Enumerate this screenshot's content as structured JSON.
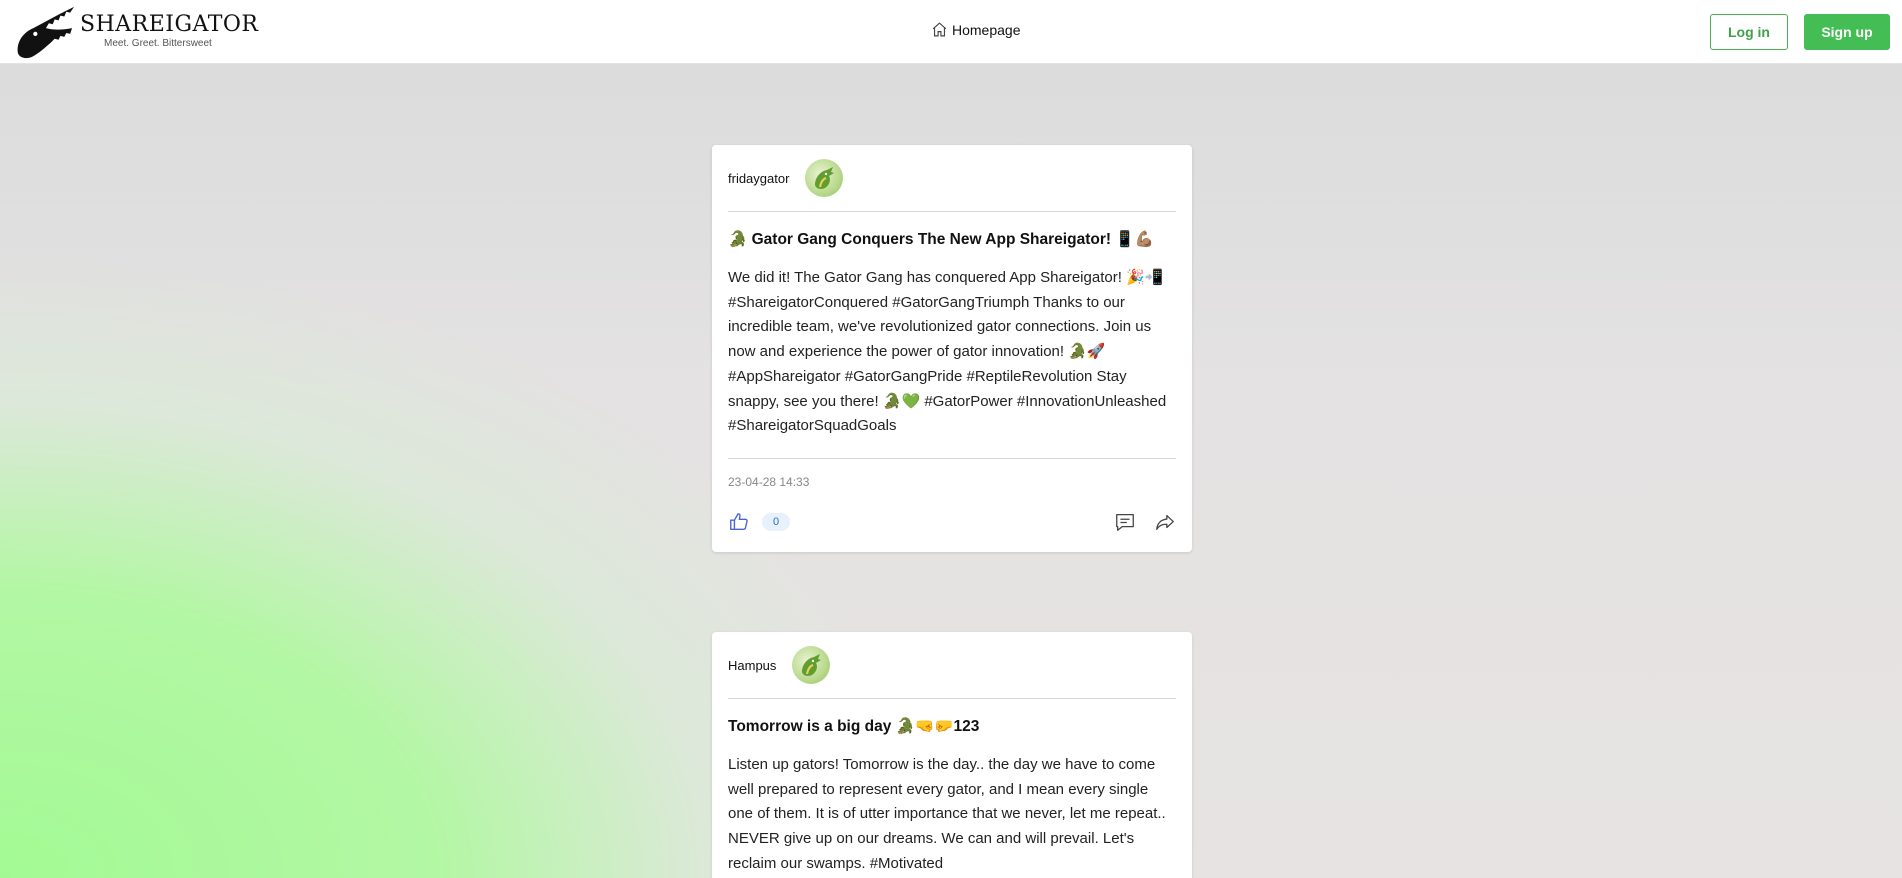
{
  "header": {
    "brand_title": "SHAREIGATOR",
    "brand_tagline": "Meet. Greet. Bittersweet",
    "nav_home_label": "Homepage",
    "login_label": "Log in",
    "signup_label": "Sign up"
  },
  "colors": {
    "brand_green": "#44bd55",
    "background_green": "#a3fa94"
  },
  "posts": [
    {
      "username": "fridaygator",
      "avatar_icon": "gator-avatar-icon",
      "title": "🐊 Gator Gang Conquers The New App Shareigator! 📱💪🏽",
      "body": "We did it! The Gator Gang has conquered App Shareigator! 🎉📲 #ShareigatorConquered #GatorGangTriumph Thanks to our incredible team, we've revolutionized gator connections. Join us now and experience the power of gator innovation! 🐊🚀 #AppShareigator #GatorGangPride #ReptileRevolution Stay snappy, see you there! 🐊💚 #GatorPower #InnovationUnleashed #ShareigatorSquadGoals",
      "timestamp": "23-04-28 14:33",
      "like_count": "0"
    },
    {
      "username": "Hampus",
      "avatar_icon": "gator-avatar-icon",
      "title": "Tomorrow is a big day 🐊🤜🤛123",
      "body": "Listen up gators! Tomorrow is the day.. the day we have to come well prepared to represent every gator, and I mean every single one of them. It is of utter importance that we never, let me repeat.. NEVER give up on our dreams. We can and will prevail. Let's reclaim our swamps. #Motivated"
    }
  ]
}
